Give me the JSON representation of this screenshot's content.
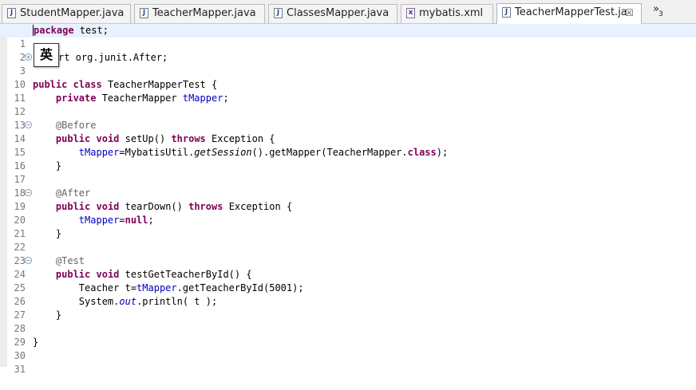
{
  "tabs": [
    {
      "label": "StudentMapper.java",
      "icon": "J"
    },
    {
      "label": "TeacherMapper.java",
      "icon": "J"
    },
    {
      "label": "ClassesMapper.java",
      "icon": "J"
    },
    {
      "label": "mybatis.xml",
      "icon": "x"
    },
    {
      "label": "TeacherMapperTest.ja",
      "icon": "J",
      "close": "☒"
    }
  ],
  "overflow": {
    "chevron": "»",
    "count": "3"
  },
  "ime": {
    "label": "英"
  },
  "lines": {
    "l1": {
      "num": "1",
      "t": [
        "package",
        " test;"
      ]
    },
    "l2": {
      "num": "2"
    },
    "l3": {
      "num": "3",
      "t": [
        "rt org.junit.After;"
      ]
    },
    "l10": {
      "num": "10"
    },
    "l11": {
      "num": "11",
      "t": [
        "public",
        " ",
        "class",
        " TeacherMapperTest {"
      ]
    },
    "l12": {
      "num": "12",
      "t": [
        "    ",
        "private",
        " TeacherMapper ",
        "tMapper",
        ";"
      ]
    },
    "l13": {
      "num": "13"
    },
    "l14": {
      "num": "14",
      "t": [
        "    ",
        "@Before"
      ]
    },
    "l15": {
      "num": "15",
      "t": [
        "    ",
        "public",
        " ",
        "void",
        " setUp() ",
        "throws",
        " Exception {"
      ]
    },
    "l16": {
      "num": "16",
      "t": [
        "        ",
        "tMapper",
        "=MybatisUtil.",
        "getSession",
        "().getMapper(TeacherMapper.",
        "class",
        ");"
      ]
    },
    "l17": {
      "num": "17",
      "t": [
        "    }"
      ]
    },
    "l18": {
      "num": "18"
    },
    "l19": {
      "num": "19",
      "t": [
        "    ",
        "@After"
      ]
    },
    "l20": {
      "num": "20",
      "t": [
        "    ",
        "public",
        " ",
        "void",
        " tearDown() ",
        "throws",
        " Exception {"
      ]
    },
    "l21": {
      "num": "21",
      "t": [
        "        ",
        "tMapper",
        "=",
        "null",
        ";"
      ]
    },
    "l22": {
      "num": "22",
      "t": [
        "    }"
      ]
    },
    "l23": {
      "num": "23"
    },
    "l24": {
      "num": "24",
      "t": [
        "    ",
        "@Test"
      ]
    },
    "l25": {
      "num": "25",
      "t": [
        "    ",
        "public",
        " ",
        "void",
        " testGetTeacherById() {"
      ]
    },
    "l26": {
      "num": "26",
      "t": [
        "        Teacher t=",
        "tMapper",
        ".getTeacherById(5001);"
      ]
    },
    "l27": {
      "num": "27",
      "t": [
        "        System.",
        "out",
        ".println( t );"
      ]
    },
    "l28": {
      "num": "28",
      "t": [
        "    }"
      ]
    },
    "l29": {
      "num": "29"
    },
    "l30": {
      "num": "30",
      "t": [
        "}"
      ]
    },
    "l31": {
      "num": "31"
    }
  },
  "colors": {
    "keyword": "#7f0055",
    "field": "#0000c0",
    "annotation": "#646464",
    "current_line": "#e8f2fe"
  }
}
